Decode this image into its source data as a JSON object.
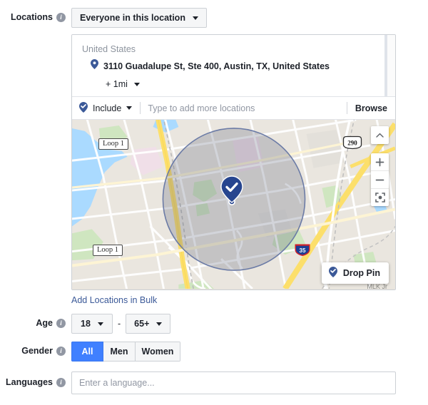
{
  "locations": {
    "label": "Locations",
    "info_icon": "info-icon",
    "audience_scope": "Everyone in this location",
    "country_group": "United States",
    "entries": [
      {
        "pin_icon": "map-pin-icon",
        "address": "3110 Guadalupe St, Ste 400, Austin, TX, United States",
        "radius": "+ 1mi"
      }
    ],
    "include_label": "Include",
    "include_icon": "check-pin-icon",
    "search_placeholder": "Type to add more locations",
    "search_value": "",
    "browse_label": "Browse",
    "bulk_link": "Add Locations in Bulk"
  },
  "map": {
    "road_shields": [
      {
        "name": "Loop 1",
        "type": "state"
      },
      {
        "name": "Loop 1",
        "type": "state"
      },
      {
        "name": "290",
        "type": "us"
      },
      {
        "name": "35",
        "type": "interstate"
      }
    ],
    "street_label": "MLK Jr",
    "pin_icon": "check-pin-icon",
    "controls": {
      "collapse_icon": "chevron-up-icon",
      "zoom_in_icon": "plus-icon",
      "zoom_out_icon": "minus-icon",
      "recenter_icon": "fullscreen-target-icon"
    },
    "drop_pin_label": "Drop Pin",
    "drop_pin_icon": "check-pin-icon"
  },
  "age": {
    "label": "Age",
    "min": "18",
    "max": "65+",
    "separator": "-"
  },
  "gender": {
    "label": "Gender",
    "options": [
      "All",
      "Men",
      "Women"
    ],
    "selected": "All"
  },
  "languages": {
    "label": "Languages",
    "placeholder": "Enter a language...",
    "value": ""
  },
  "colors": {
    "accent_blue": "#4080ff",
    "link_blue": "#3b5998",
    "pin_blue": "#27458f",
    "radius_fill": "rgba(90,100,120,0.28)",
    "border_gray": "#ccd0d5"
  }
}
